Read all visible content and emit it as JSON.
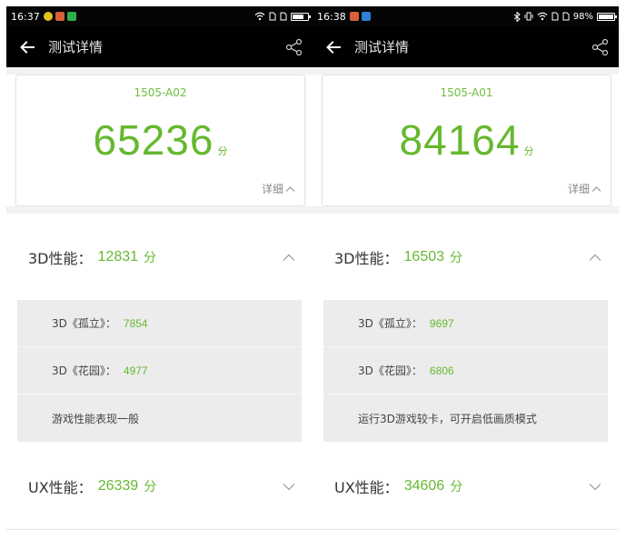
{
  "colors": {
    "accent_green": "#66b92f",
    "appbar": "#000000",
    "subpanel": "#ececec"
  },
  "phones": [
    {
      "status": {
        "time": "16:37",
        "battery_text": "",
        "battery_level": 0.7
      },
      "appbar": {
        "back_icon": "back-arrow-icon",
        "title": "测试详情",
        "share_icon": "share-icon"
      },
      "card": {
        "model": "1505-A02",
        "score": "65236",
        "unit": "分",
        "detail_label": "详细"
      },
      "gpu": {
        "label": "3D性能：",
        "value": "12831",
        "unit": "分"
      },
      "gpu_tests": [
        {
          "label": "3D《孤立》：",
          "value": "7854"
        },
        {
          "label": "3D《花园》：",
          "value": "4977"
        },
        {
          "label": "游戏性能表现一般",
          "value": ""
        }
      ],
      "ux": {
        "label": "UX性能：",
        "value": "26339",
        "unit": "分"
      }
    },
    {
      "status": {
        "time": "16:38",
        "battery_text": "98%",
        "battery_level": 0.98
      },
      "appbar": {
        "back_icon": "back-arrow-icon",
        "title": "测试详情",
        "share_icon": "share-icon"
      },
      "card": {
        "model": "1505-A01",
        "score": "84164",
        "unit": "分",
        "detail_label": "详细"
      },
      "gpu": {
        "label": "3D性能：",
        "value": "16503",
        "unit": "分"
      },
      "gpu_tests": [
        {
          "label": "3D《孤立》：",
          "value": "9697"
        },
        {
          "label": "3D《花园》：",
          "value": "6806"
        },
        {
          "label": "运行3D游戏较卡，可开启低画质模式",
          "value": ""
        }
      ],
      "ux": {
        "label": "UX性能：",
        "value": "34606",
        "unit": "分"
      }
    }
  ]
}
